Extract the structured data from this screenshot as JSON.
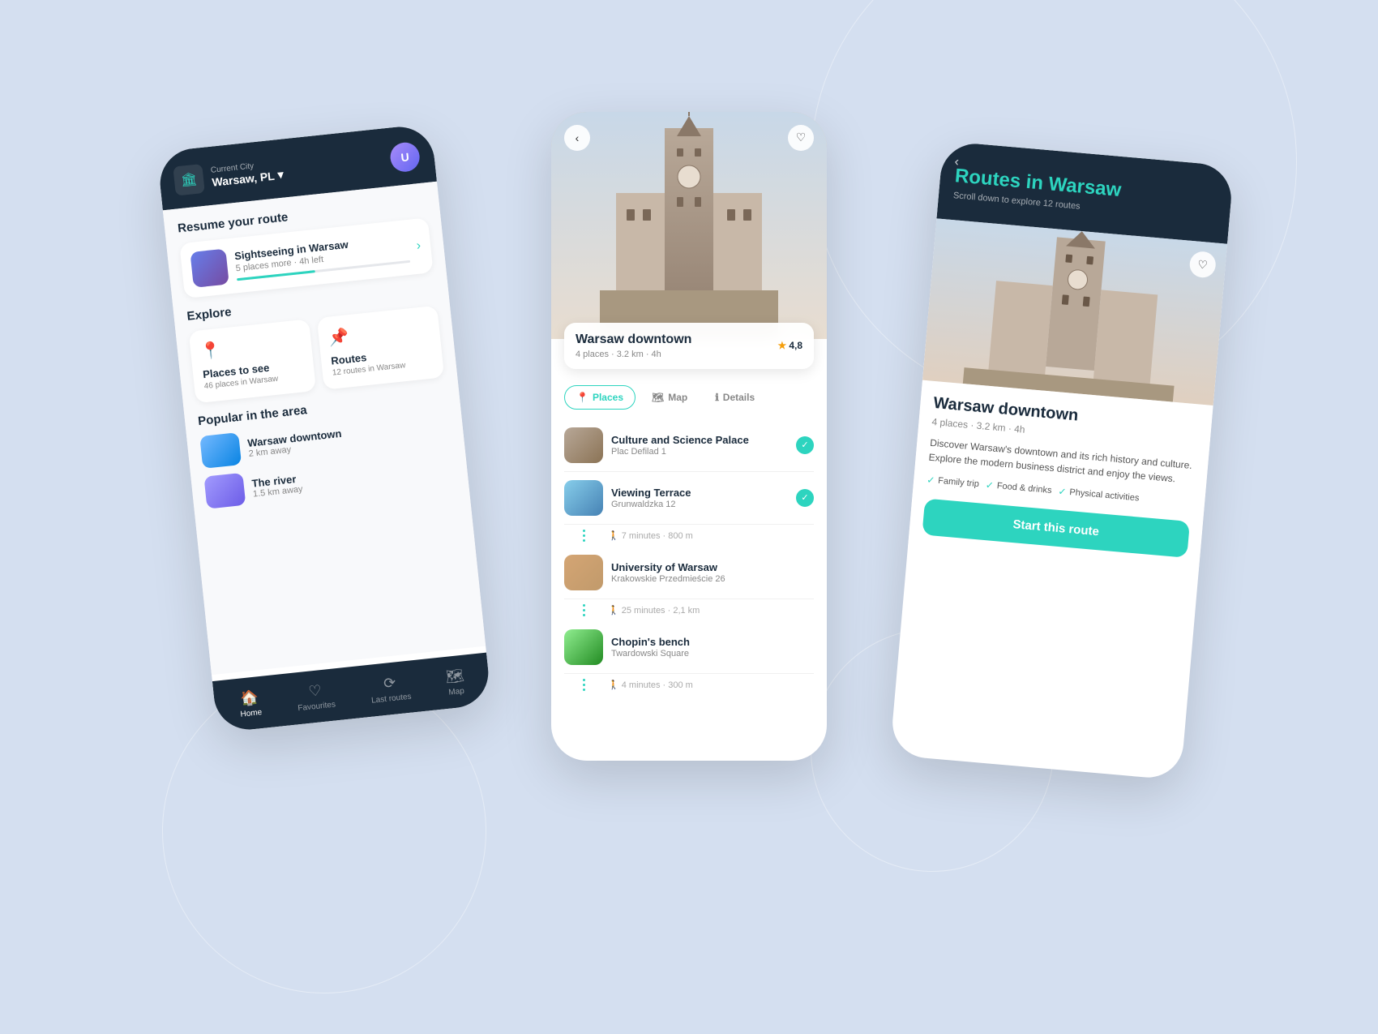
{
  "background": {
    "color": "#d4dff0"
  },
  "phone_left": {
    "header": {
      "city_label": "Current City",
      "city_name": "Warsaw, PL",
      "chevron": "▾"
    },
    "resume_section": {
      "title": "Resume your route",
      "route_name": "Sightseeing in Warsaw",
      "route_meta": "5 places more · 4h left"
    },
    "explore_section": {
      "title": "Explore",
      "places": {
        "title": "Places to see",
        "sub": "46 places in Warsaw"
      },
      "routes": {
        "title": "Routes",
        "sub": "12 routes in Warsaw"
      }
    },
    "popular_section": {
      "title": "Popular in the area",
      "items": [
        {
          "name": "Warsaw downtown",
          "dist": "2 km away"
        },
        {
          "name": "The river",
          "dist": "1.5 km away"
        }
      ]
    },
    "nav": {
      "items": [
        {
          "label": "Home",
          "icon": "🏠",
          "active": true
        },
        {
          "label": "Favourites",
          "icon": "♡",
          "active": false
        },
        {
          "label": "Last routes",
          "icon": "〰",
          "active": false
        },
        {
          "label": "Map",
          "icon": "🗺",
          "active": false
        }
      ]
    }
  },
  "phone_middle": {
    "location_name": "Warsaw downtown",
    "location_meta": "4 places · 3.2 km · 4h",
    "rating": "4,8",
    "tabs": [
      {
        "label": "Places",
        "active": true,
        "icon": "📍"
      },
      {
        "label": "Map",
        "active": false,
        "icon": "🗺"
      },
      {
        "label": "Details",
        "active": false,
        "icon": "ℹ"
      }
    ],
    "places": [
      {
        "name": "Culture and Science Palace",
        "addr": "Plac Defilad 1",
        "checked": true
      },
      {
        "name": "Viewing Terrace",
        "addr": "Grunwaldzka 12",
        "checked": true
      },
      {
        "walk": "7 minutes · 800 m"
      },
      {
        "name": "University of Warsaw",
        "addr": "Krakowskie Przedmieście 26",
        "checked": false
      },
      {
        "walk": "25 minutes · 2,1 km"
      },
      {
        "name": "Chopin's bench",
        "addr": "Twardowski Square",
        "checked": false
      },
      {
        "walk": "4 minutes · 300 m"
      }
    ]
  },
  "phone_right": {
    "back_label": "‹",
    "header_title": "Routes in",
    "header_title_accent": "Warsaw",
    "header_sub": "Scroll down to explore 12 routes",
    "route_name": "Warsaw downtown",
    "route_meta": "4 places · 3.2 km · 4h",
    "route_desc": "Discover Warsaw's downtown and its rich history and culture. Explore the modern business district and enjoy the views.",
    "tags": [
      "Family trip",
      "Food & drinks",
      "Physical activities"
    ],
    "start_button": "Start this route"
  }
}
